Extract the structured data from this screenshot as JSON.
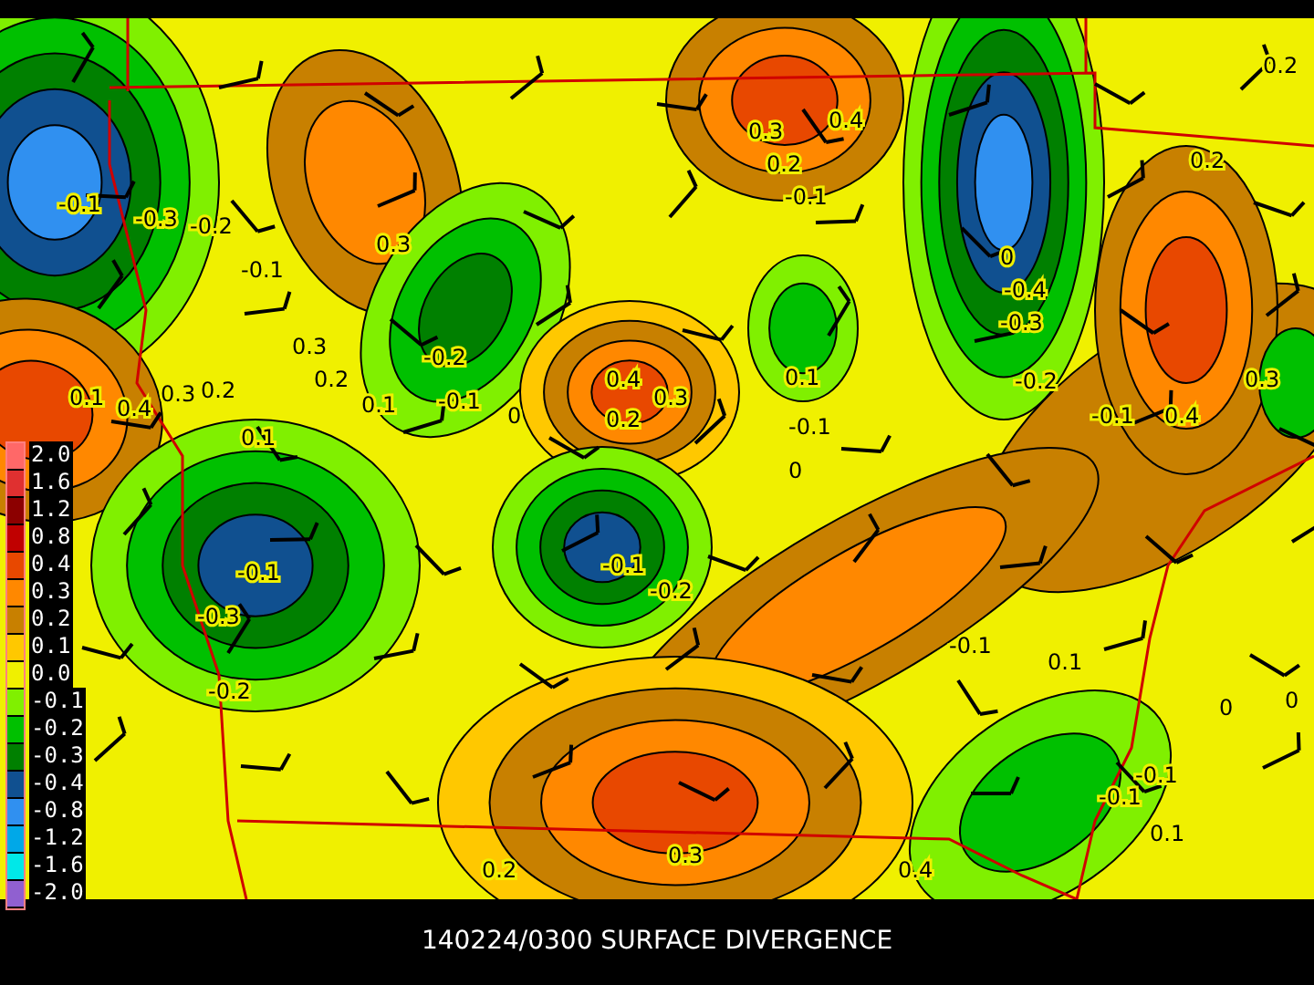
{
  "map": {
    "contour_labels": [
      "0.2",
      "0.4",
      "0.3",
      "0.2",
      "-0.1",
      "0.2",
      "-0.1",
      "-0.3",
      "-0.2",
      "-0.1",
      "0.3",
      "0.3",
      "0.2",
      "0.1",
      "-0.2",
      "-0.1",
      "0",
      "0.4",
      "0.3",
      "0.2",
      "0.1",
      "-0.1",
      "0",
      "-0.4",
      "-0.3",
      "-0.2",
      "-0.1",
      "0.4",
      "0.3",
      "0.1",
      "0.4",
      "0.3",
      "0.2",
      "0.1",
      "0",
      "-0.1",
      "-0.3",
      "-0.2",
      "-0.1",
      "-0.2",
      "-0.1",
      "0.1",
      "0",
      "0",
      "-0.1",
      "0.1",
      "0.2",
      "0.3",
      "0.4",
      "-0.1"
    ]
  },
  "legend": [
    {
      "label": "2.0",
      "color": "#ff6868"
    },
    {
      "label": "1.6",
      "color": "#e03030"
    },
    {
      "label": "1.2",
      "color": "#8c0000"
    },
    {
      "label": "0.8",
      "color": "#c00000"
    },
    {
      "label": "0.4",
      "color": "#e84800"
    },
    {
      "label": "0.3",
      "color": "#ff8800"
    },
    {
      "label": "0.2",
      "color": "#c88000"
    },
    {
      "label": "0.1",
      "color": "#ffc800"
    },
    {
      "label": "0.0",
      "color": "#f0f000"
    },
    {
      "label": "-0.1",
      "color": "#80f000"
    },
    {
      "label": "-0.2",
      "color": "#00c000"
    },
    {
      "label": "-0.3",
      "color": "#008000"
    },
    {
      "label": "-0.4",
      "color": "#105090"
    },
    {
      "label": "-0.8",
      "color": "#3090f0"
    },
    {
      "label": "-1.2",
      "color": "#00a8e8"
    },
    {
      "label": "-1.6",
      "color": "#00e8e8"
    },
    {
      "label": "-2.0",
      "color": "#9060d0"
    }
  ],
  "title": "140224/0300 SURFACE DIVERGENCE"
}
